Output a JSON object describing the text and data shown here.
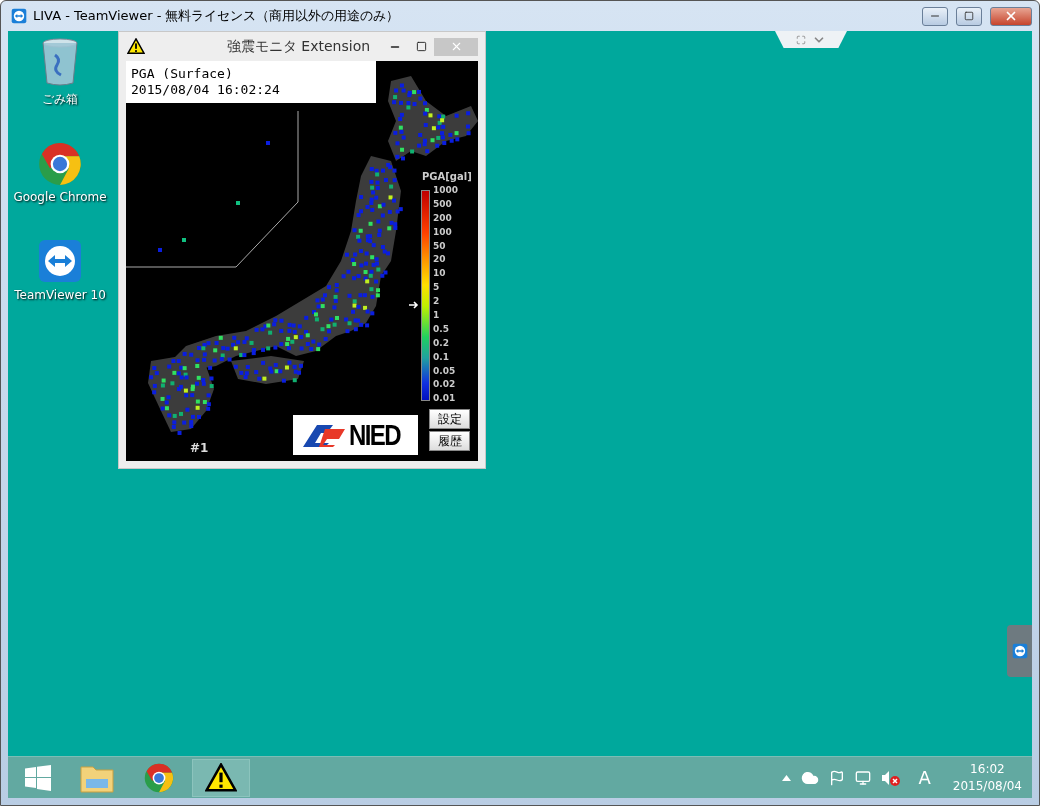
{
  "window": {
    "title": "LIVA - TeamViewer - 無料ライセンス（商用以外の用途のみ）"
  },
  "desktop_icons": [
    {
      "kind": "trash",
      "label": "ごみ箱"
    },
    {
      "kind": "chrome",
      "label": "Google Chrome"
    },
    {
      "kind": "teamviewer",
      "label": "TeamViewer 10"
    }
  ],
  "app": {
    "title": "強震モニタ Extension",
    "map_label": [
      "PGA (Surface)",
      "2015/08/04 16:02:24"
    ],
    "scale_title": "PGA[gal]",
    "scale_ticks": [
      "1000",
      "500",
      "200",
      "100",
      "50",
      "20",
      "10",
      "5",
      "2",
      "1",
      "0.5",
      "0.2",
      "0.1",
      "0.05",
      "0.02",
      "0.01"
    ],
    "station": "#1",
    "logo_text": "NIED",
    "buttons": [
      "設定",
      "履歴"
    ]
  },
  "taskbar": {
    "apps": [
      {
        "kind": "explorer",
        "selected": false
      },
      {
        "kind": "chrome",
        "selected": false
      },
      {
        "kind": "monitor",
        "selected": true
      }
    ],
    "ime": "A",
    "time": "16:02",
    "date": "2015/08/04"
  }
}
